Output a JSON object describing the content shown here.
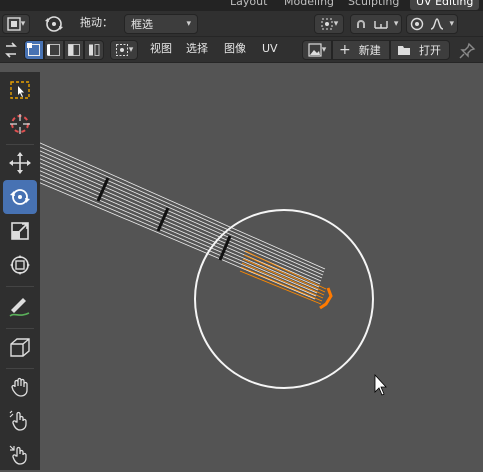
{
  "workspace_tabs": [
    {
      "label": "Layout",
      "active": false
    },
    {
      "label": "Modeling",
      "active": false
    },
    {
      "label": "Sculpting",
      "active": false
    },
    {
      "label": "UV Editing",
      "active": true
    }
  ],
  "header": {
    "drag_label": "拖动：",
    "drag_select_value": "框选",
    "menu": [
      "视图",
      "选择",
      "图像",
      "UV"
    ],
    "new_label": "新建",
    "open_label": "打开"
  },
  "toolbar": {
    "tools": [
      {
        "name": "select-box-tool",
        "active": false
      },
      {
        "name": "cursor-tool",
        "active": false
      },
      {
        "name": "move-tool",
        "active": false
      },
      {
        "name": "rotate-tool",
        "active": true
      },
      {
        "name": "scale-tool",
        "active": false
      },
      {
        "name": "transform-tool",
        "active": false
      },
      {
        "name": "annotate-tool",
        "active": false
      },
      {
        "name": "rip-region-tool",
        "active": false
      },
      {
        "name": "grab-tool",
        "active": false
      },
      {
        "name": "relax-tool",
        "active": false
      },
      {
        "name": "pinch-tool",
        "active": false
      }
    ]
  },
  "colors": {
    "accent": "#4772b3",
    "selected_uv": "#ff8a00",
    "viewport": "#545454",
    "header": "#303030"
  }
}
